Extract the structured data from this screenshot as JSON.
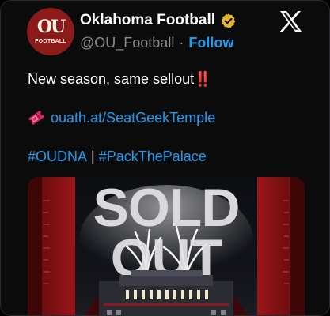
{
  "account": {
    "display_name": "Oklahoma Football",
    "handle": "@OU_Football",
    "separator": "·",
    "follow_label": "Follow",
    "avatar_logo": "OU",
    "avatar_sub": "FOOTBALL"
  },
  "tweet": {
    "line1_text": "New season, same sellout",
    "line1_emoji": "‼️",
    "link_text": "ouath.at/SeatGeekTemple",
    "hashtag1": "#OUDNA",
    "hashtag_separator": "|",
    "hashtag2": "#PackThePalace"
  },
  "media": {
    "headline_line1": "SOLD",
    "headline_line2": "OUT"
  },
  "icons": {
    "verified": "verified-badge-gold",
    "platform": "x-logo",
    "ticket": "ticket-emoji"
  },
  "colors": {
    "accent": "#1d9bf0",
    "verified": "#e8b62c",
    "brand_crimson": "#8b1a1a",
    "emoji_red": "#e0245e"
  }
}
